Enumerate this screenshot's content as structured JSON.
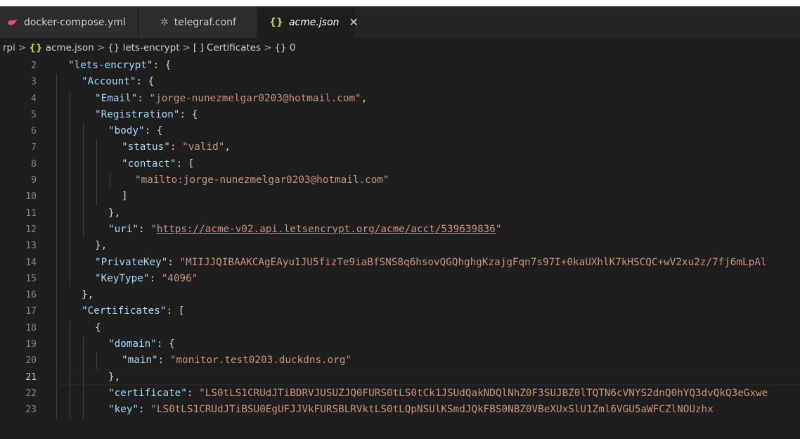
{
  "tabs": [
    {
      "label": "docker-compose.yml",
      "icon": "docker-icon",
      "active": false
    },
    {
      "label": "telegraf.conf",
      "icon": "gear-icon",
      "active": false
    },
    {
      "label": "acme.json",
      "icon": "json-braces-icon",
      "active": true,
      "icon_text": "{}",
      "close": "✕"
    }
  ],
  "breadcrumb": {
    "items": [
      "rpi",
      "acme.json",
      "lets-encrypt",
      "Certificates",
      "0"
    ],
    "prefixes": [
      "",
      "{}",
      "{}",
      "[ ]",
      "{}"
    ],
    "separator": ">"
  },
  "editor": {
    "current_line": 21,
    "lines": [
      {
        "n": "2",
        "tokens": [
          [
            "k",
            "\"lets-encrypt\""
          ],
          [
            "p",
            ": {"
          ]
        ]
      },
      {
        "n": "3",
        "tokens": [
          [
            "k",
            "\"Account\""
          ],
          [
            "p",
            ": {"
          ]
        ]
      },
      {
        "n": "4",
        "tokens": [
          [
            "k",
            "\"Email\""
          ],
          [
            "p",
            ": "
          ],
          [
            "s",
            "\"jorge-nunezmelgar0203@hotmail.com\""
          ],
          [
            "p",
            ","
          ]
        ]
      },
      {
        "n": "5",
        "tokens": [
          [
            "k",
            "\"Registration\""
          ],
          [
            "p",
            ": {"
          ]
        ]
      },
      {
        "n": "6",
        "tokens": [
          [
            "k",
            "\"body\""
          ],
          [
            "p",
            ": {"
          ]
        ]
      },
      {
        "n": "7",
        "tokens": [
          [
            "k",
            "\"status\""
          ],
          [
            "p",
            ": "
          ],
          [
            "s",
            "\"valid\""
          ],
          [
            "p",
            ","
          ]
        ]
      },
      {
        "n": "8",
        "tokens": [
          [
            "k",
            "\"contact\""
          ],
          [
            "p",
            ": ["
          ]
        ]
      },
      {
        "n": "9",
        "tokens": [
          [
            "s",
            "\"mailto:jorge-nunezmelgar0203@hotmail.com\""
          ]
        ]
      },
      {
        "n": "10",
        "tokens": [
          [
            "p",
            "]"
          ]
        ]
      },
      {
        "n": "11",
        "tokens": [
          [
            "p",
            "},"
          ]
        ]
      },
      {
        "n": "12",
        "tokens": [
          [
            "k",
            "\"uri\""
          ],
          [
            "p",
            ": "
          ],
          [
            "s",
            "\""
          ],
          [
            "u",
            "https://acme-v02.api.letsencrypt.org/acme/acct/539639836"
          ],
          [
            "s",
            "\""
          ]
        ]
      },
      {
        "n": "13",
        "tokens": [
          [
            "p",
            "},"
          ]
        ]
      },
      {
        "n": "14",
        "tokens": [
          [
            "k",
            "\"PrivateKey\""
          ],
          [
            "p",
            ": "
          ],
          [
            "s",
            "\"MIIJJQIBAAKCAgEAyu1JU5fizTe9iaBfSNS8q6hsovQGQhghgKzajgFqn7s97I+0kaUXhlK7kHSCQC+wV2xu2z/7fj6mLpAl"
          ]
        ]
      },
      {
        "n": "15",
        "tokens": [
          [
            "k",
            "\"KeyType\""
          ],
          [
            "p",
            ": "
          ],
          [
            "s",
            "\"4096\""
          ]
        ]
      },
      {
        "n": "16",
        "tokens": [
          [
            "p",
            "},"
          ]
        ]
      },
      {
        "n": "17",
        "tokens": [
          [
            "k",
            "\"Certificates\""
          ],
          [
            "p",
            ": ["
          ]
        ]
      },
      {
        "n": "18",
        "tokens": [
          [
            "p",
            "{"
          ]
        ]
      },
      {
        "n": "19",
        "tokens": [
          [
            "k",
            "\"domain\""
          ],
          [
            "p",
            ": {"
          ]
        ]
      },
      {
        "n": "20",
        "tokens": [
          [
            "k",
            "\"main\""
          ],
          [
            "p",
            ": "
          ],
          [
            "s",
            "\"monitor.test0203.duckdns.org\""
          ]
        ]
      },
      {
        "n": "21",
        "tokens": [
          [
            "p",
            "},"
          ]
        ]
      },
      {
        "n": "22",
        "tokens": [
          [
            "k",
            "\"certificate\""
          ],
          [
            "p",
            ": "
          ],
          [
            "s",
            "\"LS0tLS1CRUdJTiBDRVJUSUZJQ0FURS0tLS0tCk1JSUdQakNDQlNhZ0F3SUJBZ0lTQTN6cVNYS2dnQ0hYQ3dvQkQ3eGxwe"
          ]
        ]
      },
      {
        "n": "23",
        "tokens": [
          [
            "k",
            "\"key\""
          ],
          [
            "p",
            ": "
          ],
          [
            "s",
            "\"LS0tLS1CRUdJTiBSU0EgUFJJVkFURSBLRVktLS0tLQpNSUlKSmdJQkFBS0NBZ0VBeXUxSlU1Zml6VGU5aWFCZlNOUzhx"
          ]
        ]
      }
    ]
  },
  "colors": {
    "background": "#1e1e1e",
    "tabbar": "#252526",
    "key": "#9cdcfe",
    "string": "#ce9178",
    "punct": "#d4d4d4"
  }
}
